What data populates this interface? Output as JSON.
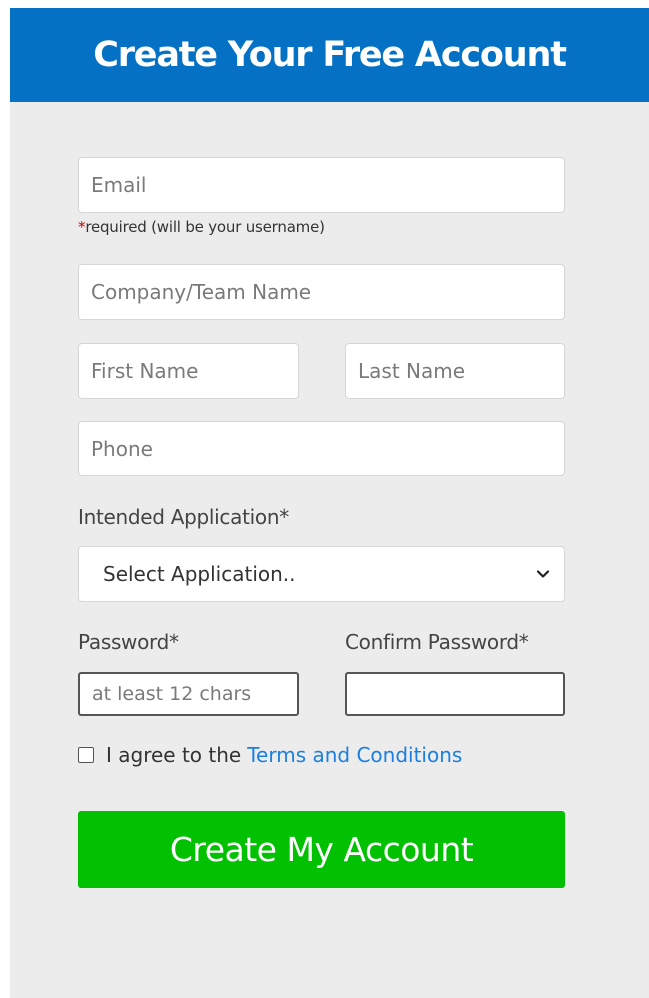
{
  "header": {
    "title": "Create Your Free Account"
  },
  "form": {
    "email": {
      "placeholder": "Email",
      "value": ""
    },
    "email_note": {
      "star": "*",
      "text": "required (will be your username)"
    },
    "company": {
      "placeholder": "Company/Team Name",
      "value": ""
    },
    "first_name": {
      "placeholder": "First Name",
      "value": ""
    },
    "last_name": {
      "placeholder": "Last Name",
      "value": ""
    },
    "phone": {
      "placeholder": "Phone",
      "value": ""
    },
    "application": {
      "label": "Intended Application*",
      "selected": "Select Application.."
    },
    "password": {
      "label": "Password*",
      "placeholder": "at least 12 chars",
      "value": ""
    },
    "confirm_password": {
      "label": "Confirm Password*",
      "placeholder": "",
      "value": ""
    },
    "agree": {
      "checked": false,
      "text": "I agree to the",
      "link": "Terms and Conditions"
    },
    "submit_label": "Create My Account"
  },
  "colors": {
    "header_bg": "#0471c4",
    "panel_bg": "#ececec",
    "submit_bg": "#02c002",
    "link": "#1a7fe0",
    "required_star": "#cc0000"
  },
  "icons": {
    "select_chevron": "chevron-down-icon"
  }
}
